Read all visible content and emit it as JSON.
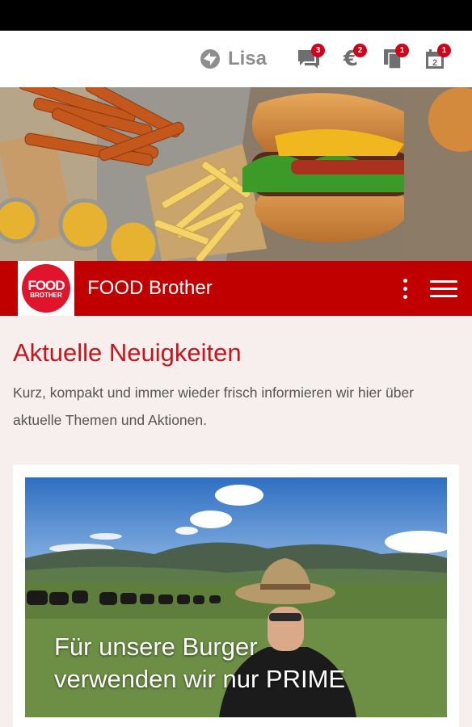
{
  "header": {
    "user_name": "Lisa",
    "badges": {
      "messages": "3",
      "euro": "2",
      "documents": "1",
      "calendar": "1"
    },
    "euro_symbol": "€",
    "calendar_day": "2"
  },
  "brand": {
    "logo_line1": "FOOD",
    "logo_line2": "BROTHER",
    "title": "FOOD Brother"
  },
  "main": {
    "heading": "Aktuelle Neuigkeiten",
    "intro": "Kurz, kompakt und immer wieder frisch informieren wir hier über aktuelle Themen und Aktionen."
  },
  "news": [
    {
      "caption_line1": "Für unsere Burger",
      "caption_line2": "verwenden wir nur PRIME"
    }
  ],
  "colors": {
    "brand_red": "#c00000",
    "heading_red": "#c8151b",
    "badge_red": "#d0021b",
    "background": "#f7eeee"
  }
}
